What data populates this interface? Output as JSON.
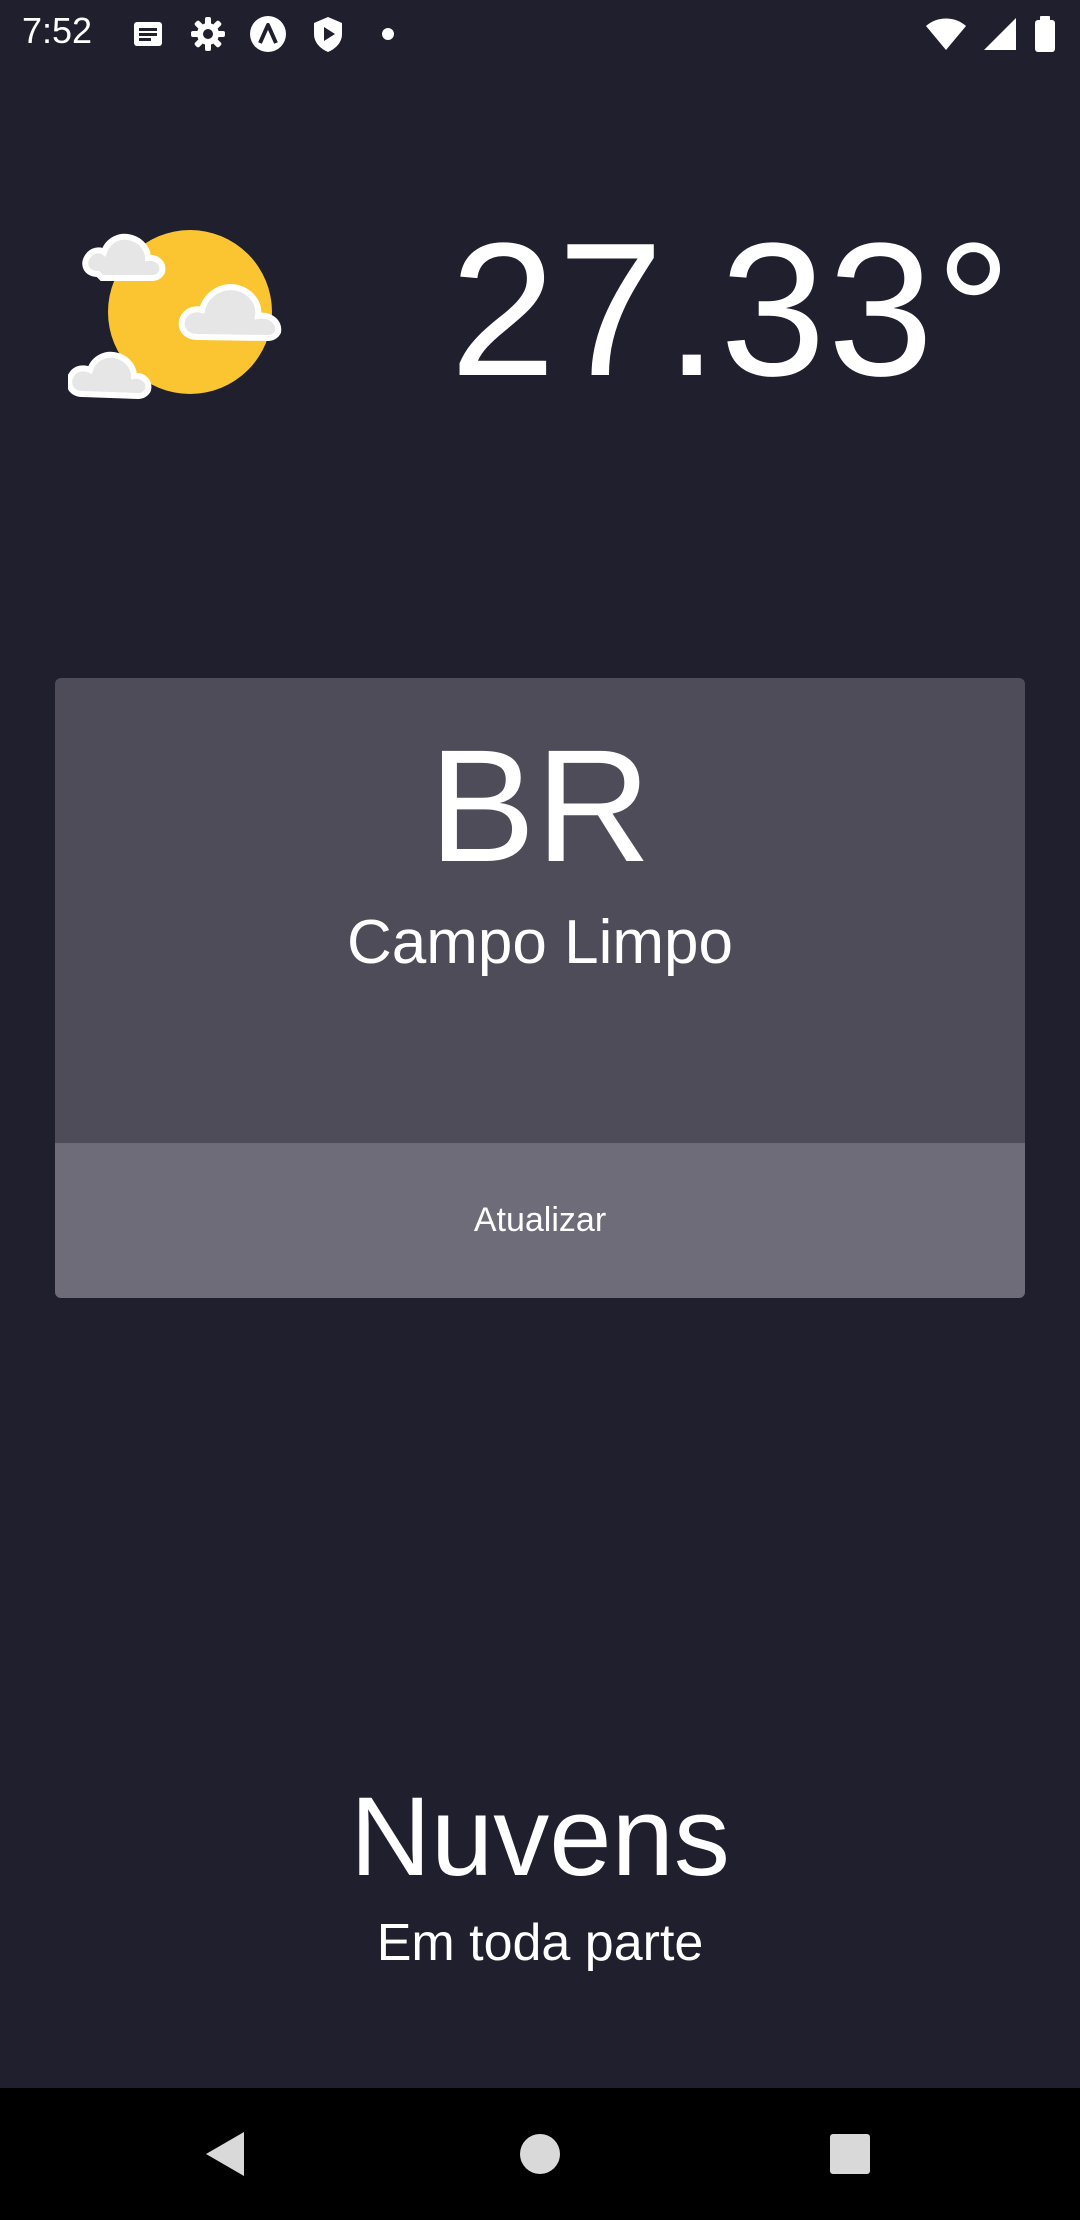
{
  "status_bar": {
    "time": "7:52",
    "left_icons": [
      "notes-icon",
      "settings-gear-icon",
      "app-a-icon",
      "shield-play-icon",
      "dot-icon"
    ],
    "right_icons": [
      "wifi-icon",
      "cell-signal-icon",
      "battery-icon"
    ]
  },
  "weather": {
    "icon": "partly-cloudy-icon",
    "temperature": "27.33°"
  },
  "location_card": {
    "country": "BR",
    "city": "Campo Limpo",
    "refresh_label": "Atualizar"
  },
  "condition": {
    "main": "Nuvens",
    "description": "Em toda parte"
  },
  "nav_bar": {
    "buttons": [
      "back-icon",
      "home-icon",
      "recents-icon"
    ]
  },
  "colors": {
    "background": "#201f2d",
    "card": "#4e4c59",
    "button": "#6e6c78",
    "sun": "#fbc531"
  }
}
